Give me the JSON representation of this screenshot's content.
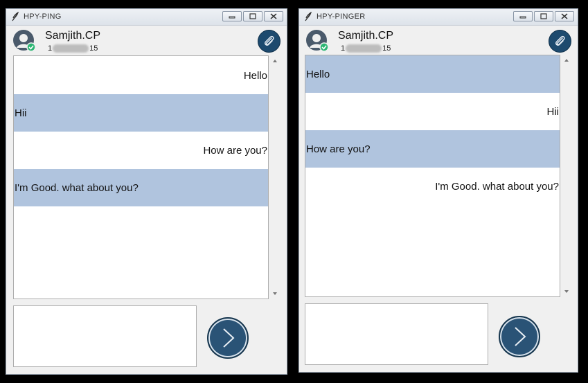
{
  "windows": [
    {
      "title": "HPY-PING",
      "contact": {
        "name": "Samjith.CP",
        "id_prefix": "1",
        "id_suffix": "15"
      },
      "messages": [
        {
          "text": "Hello",
          "side": "sent"
        },
        {
          "text": "Hii",
          "side": "received"
        },
        {
          "text": "How are you?",
          "side": "sent"
        },
        {
          "text": "I'm Good. what about you?",
          "side": "received"
        }
      ],
      "input_value": ""
    },
    {
      "title": "HPY-PINGER",
      "contact": {
        "name": "Samjith.CP",
        "id_prefix": "1",
        "id_suffix": "15"
      },
      "messages": [
        {
          "text": "Hello",
          "side": "received"
        },
        {
          "text": "Hii",
          "side": "sent"
        },
        {
          "text": "How are you?",
          "side": "received"
        },
        {
          "text": "I'm Good. what about you?",
          "side": "sent"
        }
      ],
      "input_value": ""
    }
  ],
  "colors": {
    "received_bubble": "#b0c4de",
    "send_button": "#2a5376",
    "attach_button": "#1d4a6e",
    "online_badge": "#2bb673"
  },
  "icons": [
    "feather-icon",
    "minimize-icon",
    "maximize-icon",
    "close-icon",
    "avatar-icon",
    "online-check-icon",
    "paperclip-icon",
    "chevron-right-icon"
  ]
}
